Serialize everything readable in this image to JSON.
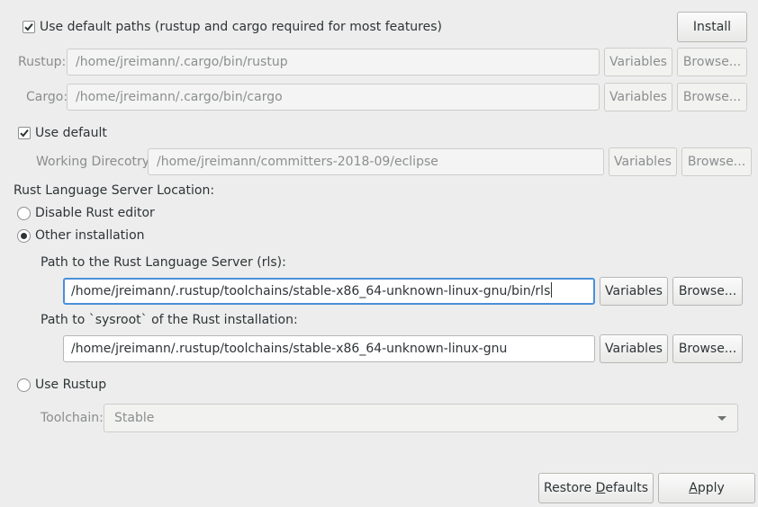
{
  "header": {
    "use_default_paths_label": "Use default paths (rustup and cargo required for most features)",
    "use_default_paths_checked": true,
    "install_label": "Install"
  },
  "rustup": {
    "label": "Rustup:",
    "value": "/home/jreimann/.cargo/bin/rustup",
    "variables_label": "Variables",
    "browse_label": "Browse..."
  },
  "cargo": {
    "label": "Cargo:",
    "value": "/home/jreimann/.cargo/bin/cargo",
    "variables_label": "Variables",
    "browse_label": "Browse..."
  },
  "working_dir": {
    "use_default_label": "Use default",
    "use_default_checked": true,
    "label": "Working Direcotry:",
    "value": "/home/jreimann/committers-2018-09/eclipse",
    "variables_label": "Variables",
    "browse_label": "Browse..."
  },
  "rls": {
    "section_label": "Rust Language Server Location:",
    "options": [
      {
        "label": "Disable Rust editor",
        "selected": false
      },
      {
        "label": "Other installation",
        "selected": true
      },
      {
        "label": "Use Rustup",
        "selected": false
      }
    ],
    "server_path_label": "Path to the Rust Language Server (rls):",
    "server_path_value": "/home/jreimann/.rustup/toolchains/stable-x86_64-unknown-linux-gnu/bin/rls",
    "sysroot_label": "Path to `sysroot` of the Rust installation:",
    "sysroot_value": "/home/jreimann/.rustup/toolchains/stable-x86_64-unknown-linux-gnu",
    "variables_label": "Variables",
    "browse_label": "Browse...",
    "toolchain_label": "Toolchain:",
    "toolchain_value": "Stable"
  },
  "footer": {
    "restore_prefix": "Restore ",
    "restore_mnemonic": "D",
    "restore_suffix": "efaults",
    "apply_mnemonic": "A",
    "apply_suffix": "pply"
  },
  "colors": {
    "focus": "#4a90d9",
    "background": "#ededed"
  }
}
